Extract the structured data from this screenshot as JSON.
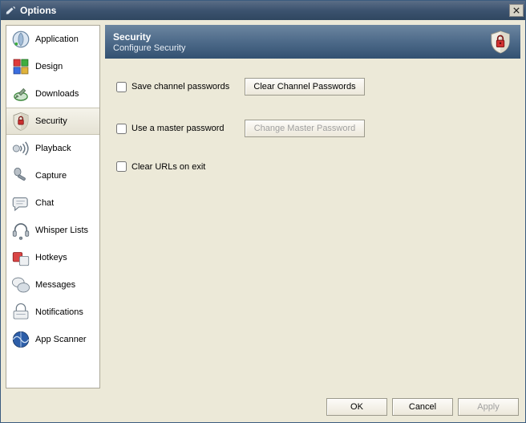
{
  "window": {
    "title": "Options"
  },
  "sidebar": {
    "items": [
      {
        "label": "Application",
        "selected": false
      },
      {
        "label": "Design",
        "selected": false
      },
      {
        "label": "Downloads",
        "selected": false
      },
      {
        "label": "Security",
        "selected": true
      },
      {
        "label": "Playback",
        "selected": false
      },
      {
        "label": "Capture",
        "selected": false
      },
      {
        "label": "Chat",
        "selected": false
      },
      {
        "label": "Whisper Lists",
        "selected": false
      },
      {
        "label": "Hotkeys",
        "selected": false
      },
      {
        "label": "Messages",
        "selected": false
      },
      {
        "label": "Notifications",
        "selected": false
      },
      {
        "label": "App Scanner",
        "selected": false
      }
    ]
  },
  "header": {
    "title": "Security",
    "subtitle": "Configure Security"
  },
  "options": {
    "save_channel_passwords": {
      "label": "Save channel passwords",
      "checked": false
    },
    "clear_channel_passwords_btn": "Clear Channel Passwords",
    "use_master_password": {
      "label": "Use a master password",
      "checked": false
    },
    "change_master_password_btn": "Change Master Password",
    "change_master_password_enabled": false,
    "clear_urls_on_exit": {
      "label": "Clear URLs on exit",
      "checked": false
    }
  },
  "footer": {
    "ok": "OK",
    "cancel": "Cancel",
    "apply": "Apply",
    "apply_enabled": false
  }
}
